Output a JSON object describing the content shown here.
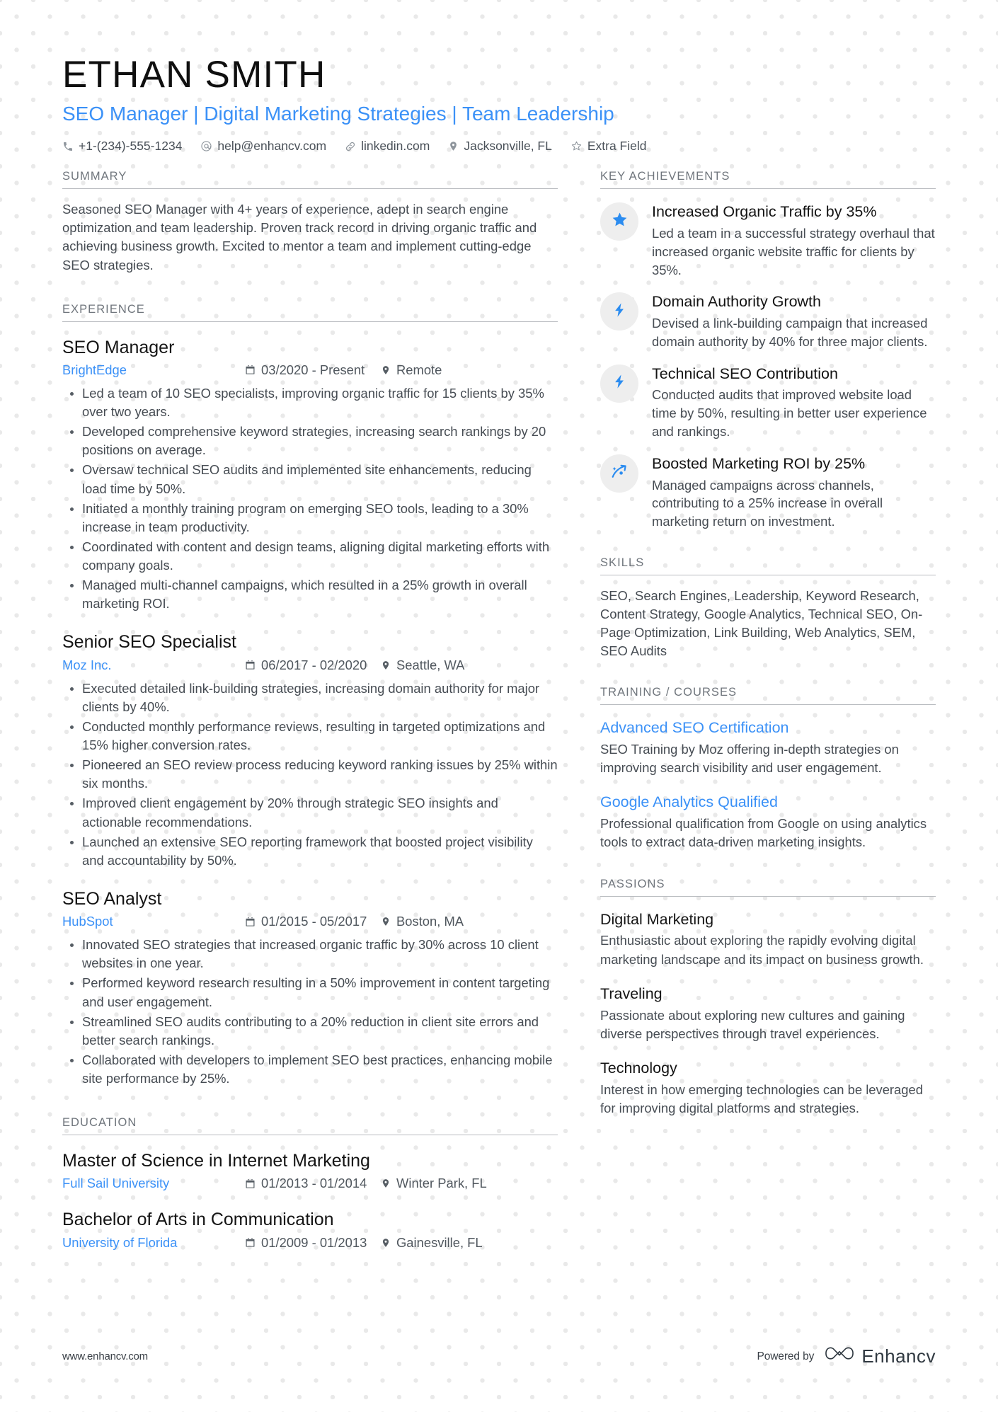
{
  "header": {
    "name": "ETHAN SMITH",
    "headline": "SEO Manager | Digital Marketing Strategies | Team Leadership",
    "contacts": [
      {
        "icon": "phone-icon",
        "text": "+1-(234)-555-1234"
      },
      {
        "icon": "email-icon",
        "text": "help@enhancv.com"
      },
      {
        "icon": "link-icon",
        "text": "linkedin.com"
      },
      {
        "icon": "location-pin-icon",
        "text": "Jacksonville, FL"
      },
      {
        "icon": "star-outline-icon",
        "text": "Extra Field"
      }
    ]
  },
  "colors": {
    "accent": "#3b91f7",
    "heading": "#6f757c",
    "body": "#464c53",
    "title": "#141414",
    "badge_bg": "#eeeeee",
    "rule": "#b9bcc0",
    "dot_pattern": "#e9e9e9"
  },
  "summary": {
    "section_title": "SUMMARY",
    "text": "Seasoned SEO Manager with 4+ years of experience, adept in search engine optimization and team leadership. Proven track record in driving organic traffic and achieving business growth. Excited to mentor a team and implement cutting-edge SEO strategies."
  },
  "experience": {
    "section_title": "EXPERIENCE",
    "entries": [
      {
        "title": "SEO Manager",
        "org": "BrightEdge",
        "date": "03/2020 - Present",
        "location": "Remote",
        "bullets": [
          "Led a team of 10 SEO specialists, improving organic traffic for 15 clients by 35% over two years.",
          "Developed comprehensive keyword strategies, increasing search rankings by 20 positions on average.",
          "Oversaw technical SEO audits and implemented site enhancements, reducing load time by 50%.",
          "Initiated a monthly training program on emerging SEO tools, leading to a 30% increase in team productivity.",
          "Coordinated with content and design teams, aligning digital marketing efforts with company goals.",
          "Managed multi-channel campaigns, which resulted in a 25% growth in overall marketing ROI."
        ]
      },
      {
        "title": "Senior SEO Specialist",
        "org": "Moz Inc.",
        "date": "06/2017 - 02/2020",
        "location": "Seattle, WA",
        "bullets": [
          "Executed detailed link-building strategies, increasing domain authority for major clients by 40%.",
          "Conducted monthly performance reviews, resulting in targeted optimizations and 15% higher conversion rates.",
          "Pioneered an SEO review process reducing keyword ranking issues by 25% within six months.",
          "Improved client engagement by 20% through strategic SEO insights and actionable recommendations.",
          "Launched an extensive SEO reporting framework that boosted project visibility and accountability by 50%."
        ]
      },
      {
        "title": "SEO Analyst",
        "org": "HubSpot",
        "date": "01/2015 - 05/2017",
        "location": "Boston, MA",
        "bullets": [
          "Innovated SEO strategies that increased organic traffic by 30% across 10 client websites in one year.",
          "Performed keyword research resulting in a 50% improvement in content targeting and user engagement.",
          "Streamlined SEO audits contributing to a 20% reduction in client site errors and better search rankings.",
          "Collaborated with developers to implement SEO best practices, enhancing mobile site performance by 25%."
        ]
      }
    ]
  },
  "education": {
    "section_title": "EDUCATION",
    "entries": [
      {
        "title": "Master of Science in Internet Marketing",
        "org": "Full Sail University",
        "date": "01/2013 - 01/2014",
        "location": "Winter Park, FL"
      },
      {
        "title": "Bachelor of Arts in Communication",
        "org": "University of Florida",
        "date": "01/2009 - 01/2013",
        "location": "Gainesville, FL"
      }
    ]
  },
  "key_achievements": {
    "section_title": "KEY ACHIEVEMENTS",
    "items": [
      {
        "icon": "star-icon",
        "title": "Increased Organic Traffic by 35%",
        "desc": "Led a team in a successful strategy overhaul that increased organic website traffic for clients by 35%."
      },
      {
        "icon": "lightning-bolt-icon",
        "title": "Domain Authority Growth",
        "desc": "Devised a link-building campaign that increased domain authority by 40% for three major clients."
      },
      {
        "icon": "lightning-bolt-icon",
        "title": "Technical SEO Contribution",
        "desc": "Conducted audits that improved website load time by 50%, resulting in better user experience and rankings."
      },
      {
        "icon": "trend-arrow-icon",
        "title": "Boosted Marketing ROI by 25%",
        "desc": "Managed campaigns across channels, contributing to a 25% increase in overall marketing return on investment."
      }
    ]
  },
  "skills": {
    "section_title": "SKILLS",
    "text": "SEO, Search Engines, Leadership, Keyword Research, Content Strategy, Google Analytics, Technical SEO, On-Page Optimization, Link Building, Web Analytics, SEM, SEO Audits"
  },
  "training": {
    "section_title": "TRAINING / COURSES",
    "items": [
      {
        "title": "Advanced SEO Certification",
        "desc": "SEO Training by Moz offering in-depth strategies on improving search visibility and user engagement."
      },
      {
        "title": "Google Analytics Qualified",
        "desc": "Professional qualification from Google on using analytics tools to extract data-driven marketing insights."
      }
    ]
  },
  "passions": {
    "section_title": "PASSIONS",
    "items": [
      {
        "title": "Digital Marketing",
        "desc": "Enthusiastic about exploring the rapidly evolving digital marketing landscape and its impact on business growth."
      },
      {
        "title": "Traveling",
        "desc": "Passionate about exploring new cultures and gaining diverse perspectives through travel experiences."
      },
      {
        "title": "Technology",
        "desc": "Interest in how emerging technologies can be leveraged for improving digital platforms and strategies."
      }
    ]
  },
  "footer": {
    "url": "www.enhancv.com",
    "powered_by": "Powered by",
    "brand": "Enhancv"
  }
}
